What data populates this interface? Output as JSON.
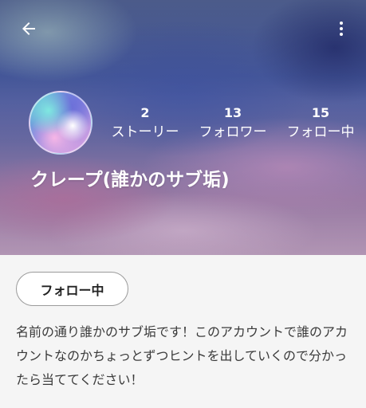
{
  "header": {
    "back_icon": "arrow-left-icon",
    "more_icon": "more-vert-icon"
  },
  "profile": {
    "name": "クレープ(誰かのサブ垢)",
    "avatar": "avatar-image",
    "stats": [
      {
        "value": "2",
        "label": "ストーリー"
      },
      {
        "value": "13",
        "label": "フォロワー"
      },
      {
        "value": "15",
        "label": "フォロー中"
      }
    ]
  },
  "actions": {
    "follow_label": "フォロー中"
  },
  "bio": {
    "text": "名前の通り誰かのサブ垢です！このアカウントで誰のアカウントなのかちょっとずつヒントを出していくので分かったら当ててください！"
  }
}
